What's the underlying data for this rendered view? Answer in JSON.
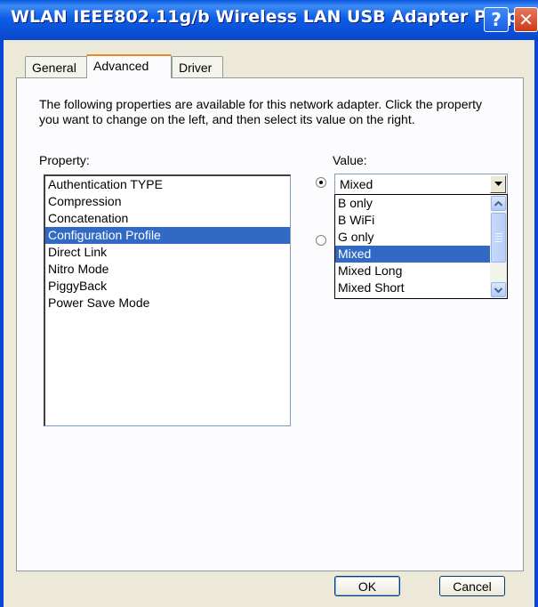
{
  "window": {
    "title": "WLAN IEEE802.11g/b Wireless LAN USB Adapter Prop...",
    "help_label": "?",
    "close_label": "✕"
  },
  "tabs": [
    {
      "label": "General",
      "selected": false
    },
    {
      "label": "Advanced",
      "selected": true
    },
    {
      "label": "Driver",
      "selected": false
    }
  ],
  "advanced": {
    "description": "The following properties are available for this network adapter. Click the property you want to change on the left, and then select its value on the right.",
    "property_label": "Property:",
    "value_label": "Value:",
    "properties": [
      "Authentication TYPE",
      "Compression",
      "Concatenation",
      "Configuration Profile",
      "Direct Link",
      "Nitro Mode",
      "PiggyBack",
      "Power Save Mode"
    ],
    "selected_property": "Configuration Profile",
    "value_combo": "Mixed",
    "value_options": [
      "B only",
      "B WiFi",
      "G only",
      "Mixed",
      "Mixed Long",
      "Mixed Short"
    ],
    "selected_option": "Mixed"
  },
  "buttons": {
    "ok": "OK",
    "cancel": "Cancel"
  },
  "colors": {
    "titlebar": "#0a46d8",
    "selection": "#316ac5",
    "dialog_bg": "#ece9d8"
  }
}
